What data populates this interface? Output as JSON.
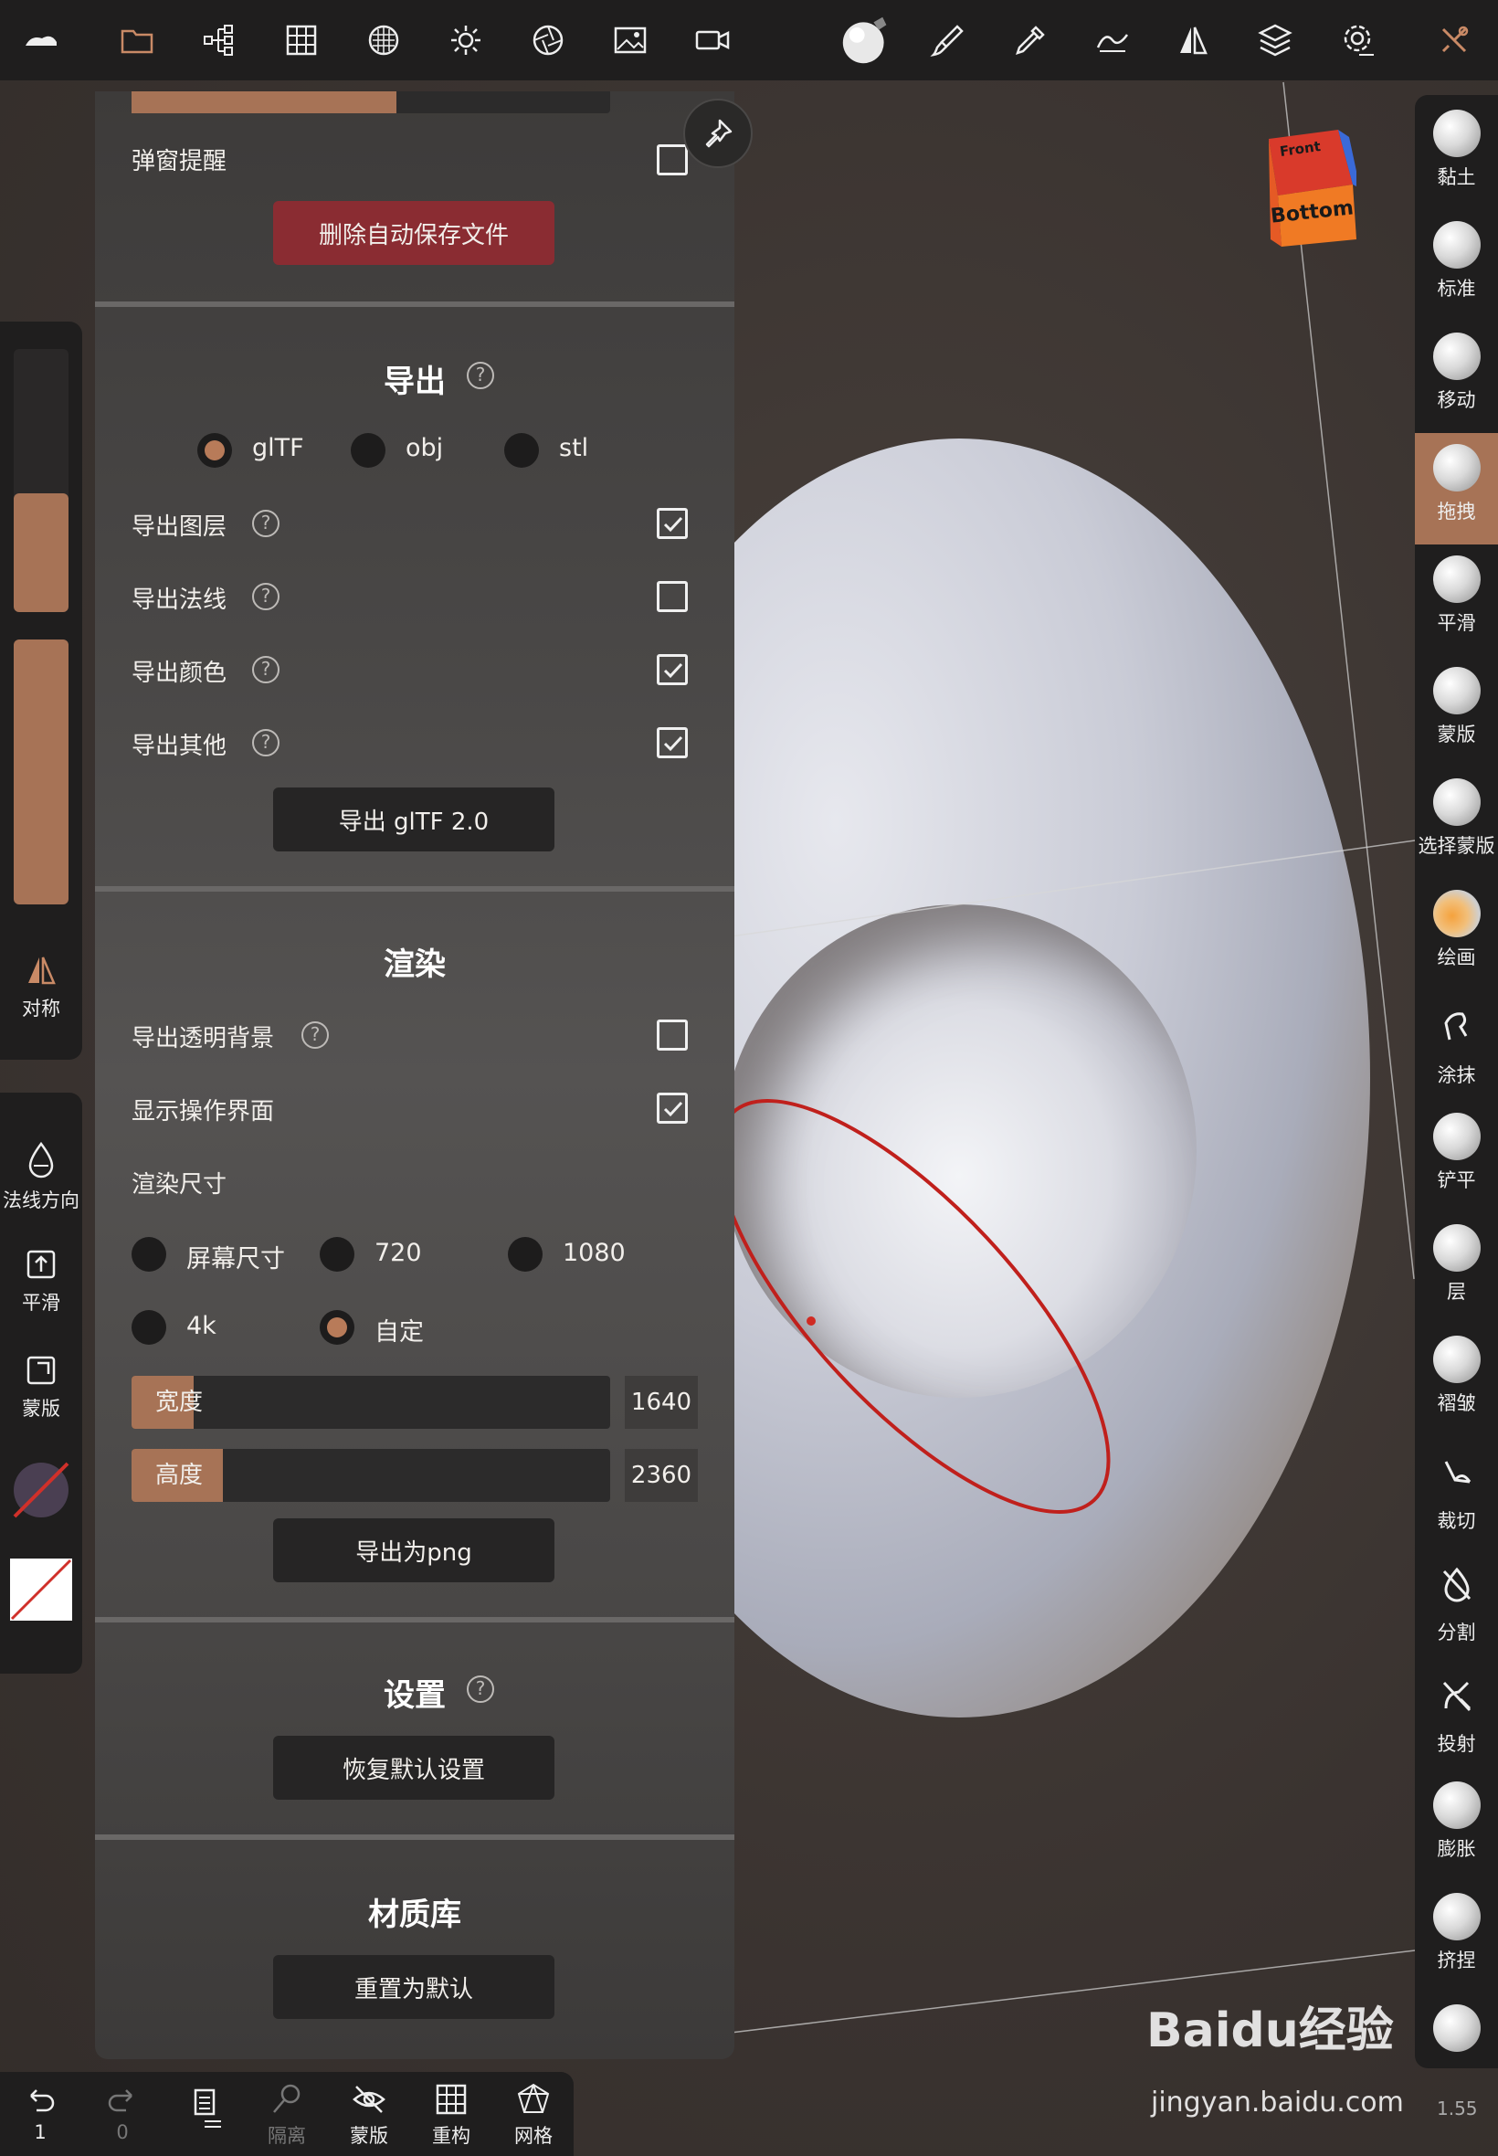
{
  "toolbar": {
    "icons": [
      "logo-icon",
      "folder-icon",
      "scene-tree-icon",
      "grid-icon",
      "topology-icon",
      "light-icon",
      "aperture-icon",
      "image-icon",
      "camera-icon",
      "material-sphere-icon",
      "brush-icon",
      "dropper-icon",
      "stroke-icon",
      "symmetry-icon",
      "layers-icon",
      "settings-icon",
      "tools-icon"
    ]
  },
  "panel": {
    "popup_reminder_label": "弹窗提醒",
    "delete_autosave_label": "删除自动保存文件",
    "export": {
      "title": "导出",
      "formats": [
        "glTF",
        "obj",
        "stl"
      ],
      "selected_format": "glTF",
      "options": [
        {
          "label": "导出图层",
          "checked": true
        },
        {
          "label": "导出法线",
          "checked": false
        },
        {
          "label": "导出颜色",
          "checked": true
        },
        {
          "label": "导出其他",
          "checked": true
        }
      ],
      "export_button": "导出 glTF 2.0"
    },
    "render": {
      "title": "渲染",
      "transparent_bg_label": "导出透明背景",
      "transparent_bg_checked": false,
      "show_ui_label": "显示操作界面",
      "show_ui_checked": true,
      "size_label": "渲染尺寸",
      "sizes": [
        "屏幕尺寸",
        "720",
        "1080",
        "4k",
        "自定"
      ],
      "selected_size": "自定",
      "width_label": "宽度",
      "width_value": "1640",
      "width_fill": 0.13,
      "height_label": "高度",
      "height_value": "2360",
      "height_fill": 0.19,
      "export_png_button": "导出为png"
    },
    "settings": {
      "title": "设置",
      "reset_button": "恢复默认设置"
    },
    "material": {
      "title": "材质库",
      "reset_button": "重置为默认"
    }
  },
  "left_panel": {
    "symmetry_label": "对称",
    "normal_dir_label": "法线方向",
    "smooth_label": "平滑",
    "mask_label": "蒙版",
    "slider_top_fill": 0.45,
    "slider_bottom_fill": 1.0
  },
  "brushes": [
    {
      "label": "黏土",
      "active": false
    },
    {
      "label": "标准",
      "active": false
    },
    {
      "label": "移动",
      "active": false
    },
    {
      "label": "拖拽",
      "active": true
    },
    {
      "label": "平滑",
      "active": false
    },
    {
      "label": "蒙版",
      "active": false
    },
    {
      "label": "选择蒙版",
      "active": false
    },
    {
      "label": "绘画",
      "active": false
    },
    {
      "label": "涂抹",
      "active": false
    },
    {
      "label": "铲平",
      "active": false
    },
    {
      "label": "层",
      "active": false
    },
    {
      "label": "褶皱",
      "active": false
    },
    {
      "label": "裁切",
      "active": false
    },
    {
      "label": "分割",
      "active": false
    },
    {
      "label": "投射",
      "active": false
    },
    {
      "label": "膨胀",
      "active": false
    },
    {
      "label": "挤捏",
      "active": false
    }
  ],
  "bottom_bar": {
    "undo_count": "1",
    "redo_count": "0",
    "isolate_label": "隔离",
    "mask_label": "蒙版",
    "remesh_label": "重构",
    "mesh_label": "网格"
  },
  "nav_cube": {
    "front_label": "Front",
    "bottom_label": "Bottom"
  },
  "watermark": {
    "text": "Baidu经验",
    "url": "jingyan.baidu.com"
  },
  "version": "1.55",
  "colors": {
    "accent": "#a77356",
    "danger": "#8a2c32",
    "toolbar_bg": "#1f1e1e"
  }
}
